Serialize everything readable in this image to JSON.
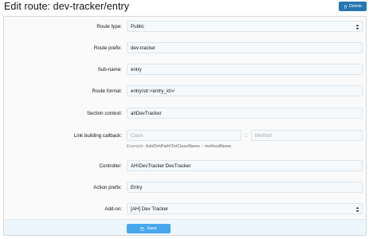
{
  "header": {
    "title": "Edit route: dev-tracker/entry",
    "delete_label": "Delete"
  },
  "form": {
    "route_type": {
      "label": "Route type:",
      "value": "Public"
    },
    "route_prefix": {
      "label": "Route prefix:",
      "value": "dev-tracker"
    },
    "sub_name": {
      "label": "Sub-name:",
      "value": "entry"
    },
    "route_format": {
      "label": "Route format:",
      "value": "entry/str:<entry_id>/"
    },
    "section_context": {
      "label": "Section context:",
      "value": "ahDevTracker"
    },
    "link_callback": {
      "label": "Link building callback:",
      "class_placeholder": "Class",
      "separator": "::",
      "method_placeholder": "Method",
      "hint_prefix": "Example:",
      "hint_class": "AddOn\\Path\\To\\ClassName",
      "hint_sep": "::",
      "hint_method": "methodName"
    },
    "controller": {
      "label": "Controller:",
      "value": "AH\\DevTracker:DevTracker"
    },
    "action_prefix": {
      "label": "Action prefix:",
      "value": "Entry"
    },
    "addon": {
      "label": "Add-on:",
      "value": "[AH] Dev Tracker"
    }
  },
  "footer": {
    "save_label": "Save"
  },
  "colors": {
    "primary": "#2577b1",
    "save": "#47a7eb",
    "footer_bg": "#edf6fd"
  }
}
